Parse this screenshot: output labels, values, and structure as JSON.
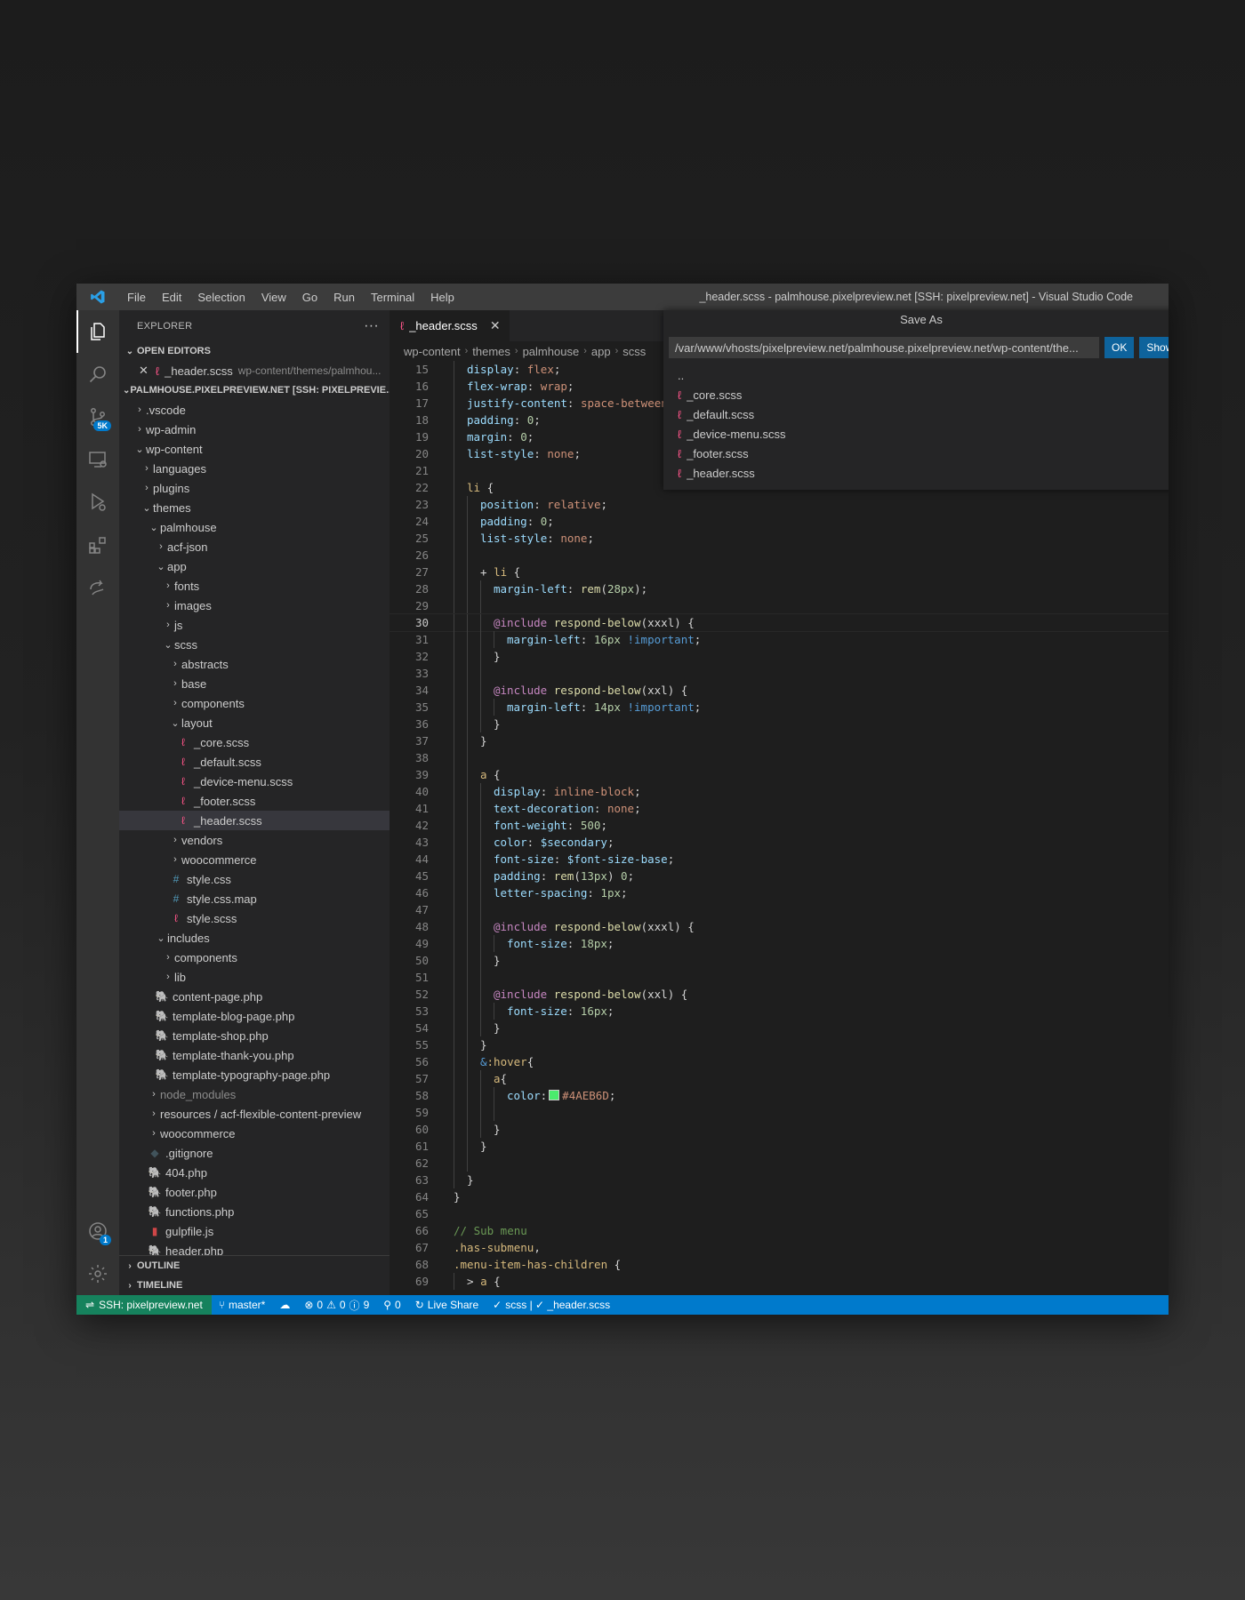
{
  "window": {
    "title": "_header.scss - palmhouse.pixelpreview.net [SSH: pixelpreview.net] - Visual Studio Code",
    "menu": [
      "File",
      "Edit",
      "Selection",
      "View",
      "Go",
      "Run",
      "Terminal",
      "Help"
    ]
  },
  "activity": {
    "source_control_badge": "5K",
    "accounts_badge": "1"
  },
  "sidebar": {
    "title": "EXPLORER",
    "more_label": "···",
    "open_editors_label": "OPEN EDITORS",
    "open_editor": {
      "name": "_header.scss",
      "path": "wp-content/themes/palmhou..."
    },
    "workspace_label": "PALMHOUSE.PIXELPREVIEW.NET [SSH: PIXELPREVIE...",
    "tree": [
      {
        "label": ".vscode",
        "depth": 0,
        "type": "folder",
        "open": false
      },
      {
        "label": "wp-admin",
        "depth": 0,
        "type": "folder",
        "open": false
      },
      {
        "label": "wp-content",
        "depth": 0,
        "type": "folder",
        "open": true
      },
      {
        "label": "languages",
        "depth": 1,
        "type": "folder",
        "open": false
      },
      {
        "label": "plugins",
        "depth": 1,
        "type": "folder",
        "open": false
      },
      {
        "label": "themes",
        "depth": 1,
        "type": "folder",
        "open": true
      },
      {
        "label": "palmhouse",
        "depth": 2,
        "type": "folder",
        "open": true
      },
      {
        "label": "acf-json",
        "depth": 3,
        "type": "folder",
        "open": false
      },
      {
        "label": "app",
        "depth": 3,
        "type": "folder",
        "open": true
      },
      {
        "label": "fonts",
        "depth": 4,
        "type": "folder",
        "open": false
      },
      {
        "label": "images",
        "depth": 4,
        "type": "folder",
        "open": false
      },
      {
        "label": "js",
        "depth": 4,
        "type": "folder",
        "open": false
      },
      {
        "label": "scss",
        "depth": 4,
        "type": "folder",
        "open": true
      },
      {
        "label": "abstracts",
        "depth": 5,
        "type": "folder",
        "open": false
      },
      {
        "label": "base",
        "depth": 5,
        "type": "folder",
        "open": false
      },
      {
        "label": "components",
        "depth": 5,
        "type": "folder",
        "open": false
      },
      {
        "label": "layout",
        "depth": 5,
        "type": "folder",
        "open": true
      },
      {
        "label": "_core.scss",
        "depth": 6,
        "type": "scss"
      },
      {
        "label": "_default.scss",
        "depth": 6,
        "type": "scss"
      },
      {
        "label": "_device-menu.scss",
        "depth": 6,
        "type": "scss"
      },
      {
        "label": "_footer.scss",
        "depth": 6,
        "type": "scss"
      },
      {
        "label": "_header.scss",
        "depth": 6,
        "type": "scss",
        "selected": true
      },
      {
        "label": "vendors",
        "depth": 5,
        "type": "folder",
        "open": false
      },
      {
        "label": "woocommerce",
        "depth": 5,
        "type": "folder",
        "open": false
      },
      {
        "label": "style.css",
        "depth": 5,
        "type": "css"
      },
      {
        "label": "style.css.map",
        "depth": 5,
        "type": "css"
      },
      {
        "label": "style.scss",
        "depth": 5,
        "type": "scss"
      },
      {
        "label": "includes",
        "depth": 3,
        "type": "folder",
        "open": true
      },
      {
        "label": "components",
        "depth": 4,
        "type": "folder",
        "open": false
      },
      {
        "label": "lib",
        "depth": 4,
        "type": "folder",
        "open": false
      },
      {
        "label": "content-page.php",
        "depth": 3,
        "type": "php"
      },
      {
        "label": "template-blog-page.php",
        "depth": 3,
        "type": "php"
      },
      {
        "label": "template-shop.php",
        "depth": 3,
        "type": "php"
      },
      {
        "label": "template-thank-you.php",
        "depth": 3,
        "type": "php"
      },
      {
        "label": "template-typography-page.php",
        "depth": 3,
        "type": "php"
      },
      {
        "label": "node_modules",
        "depth": 2,
        "type": "folder",
        "open": false,
        "dim": true
      },
      {
        "label": "resources / acf-flexible-content-preview",
        "depth": 2,
        "type": "folder",
        "open": false
      },
      {
        "label": "woocommerce",
        "depth": 2,
        "type": "folder",
        "open": false
      },
      {
        "label": ".gitignore",
        "depth": 2,
        "type": "git"
      },
      {
        "label": "404.php",
        "depth": 2,
        "type": "php"
      },
      {
        "label": "footer.php",
        "depth": 2,
        "type": "php"
      },
      {
        "label": "functions.php",
        "depth": 2,
        "type": "php"
      },
      {
        "label": "gulpfile.js",
        "depth": 2,
        "type": "gulp"
      },
      {
        "label": "header.php",
        "depth": 2,
        "type": "php"
      }
    ],
    "outline_label": "OUTLINE",
    "timeline_label": "TIMELINE"
  },
  "editor": {
    "tab_label": "_header.scss",
    "breadcrumb": [
      "wp-content",
      "themes",
      "palmhouse",
      "app",
      "scss"
    ],
    "current_line": 30,
    "lines": [
      {
        "n": 15,
        "i": 2,
        "t": [
          [
            "display",
            "k-prop"
          ],
          [
            ": ",
            "k-p"
          ],
          [
            "flex",
            "k-val"
          ],
          [
            ";",
            "k-p"
          ]
        ]
      },
      {
        "n": 16,
        "i": 2,
        "t": [
          [
            "flex-wrap",
            "k-prop"
          ],
          [
            ": ",
            "k-p"
          ],
          [
            "wrap",
            "k-val"
          ],
          [
            ";",
            "k-p"
          ]
        ]
      },
      {
        "n": 17,
        "i": 2,
        "t": [
          [
            "justify-content",
            "k-prop"
          ],
          [
            ": ",
            "k-p"
          ],
          [
            "space-between",
            "k-val"
          ],
          [
            ";",
            "k-p"
          ]
        ]
      },
      {
        "n": 18,
        "i": 2,
        "t": [
          [
            "padding",
            "k-prop"
          ],
          [
            ": ",
            "k-p"
          ],
          [
            "0",
            "k-num"
          ],
          [
            ";",
            "k-p"
          ]
        ]
      },
      {
        "n": 19,
        "i": 2,
        "t": [
          [
            "margin",
            "k-prop"
          ],
          [
            ": ",
            "k-p"
          ],
          [
            "0",
            "k-num"
          ],
          [
            ";",
            "k-p"
          ]
        ]
      },
      {
        "n": 20,
        "i": 2,
        "t": [
          [
            "list-style",
            "k-prop"
          ],
          [
            ": ",
            "k-p"
          ],
          [
            "none",
            "k-val"
          ],
          [
            ";",
            "k-p"
          ]
        ]
      },
      {
        "n": 21,
        "i": 2,
        "t": []
      },
      {
        "n": 22,
        "i": 2,
        "t": [
          [
            "li",
            "k-sel"
          ],
          [
            " {",
            "k-p"
          ]
        ]
      },
      {
        "n": 23,
        "i": 3,
        "t": [
          [
            "position",
            "k-prop"
          ],
          [
            ": ",
            "k-p"
          ],
          [
            "relative",
            "k-val"
          ],
          [
            ";",
            "k-p"
          ]
        ]
      },
      {
        "n": 24,
        "i": 3,
        "t": [
          [
            "padding",
            "k-prop"
          ],
          [
            ": ",
            "k-p"
          ],
          [
            "0",
            "k-num"
          ],
          [
            ";",
            "k-p"
          ]
        ]
      },
      {
        "n": 25,
        "i": 3,
        "t": [
          [
            "list-style",
            "k-prop"
          ],
          [
            ": ",
            "k-p"
          ],
          [
            "none",
            "k-val"
          ],
          [
            ";",
            "k-p"
          ]
        ]
      },
      {
        "n": 26,
        "i": 3,
        "t": []
      },
      {
        "n": 27,
        "i": 3,
        "t": [
          [
            "+ ",
            "k-p"
          ],
          [
            "li",
            "k-sel"
          ],
          [
            " {",
            "k-p"
          ]
        ]
      },
      {
        "n": 28,
        "i": 4,
        "t": [
          [
            "margin-left",
            "k-prop"
          ],
          [
            ": ",
            "k-p"
          ],
          [
            "rem",
            "k-fn"
          ],
          [
            "(",
            "k-p"
          ],
          [
            "28px",
            "k-num"
          ],
          [
            ");",
            "k-p"
          ]
        ]
      },
      {
        "n": 29,
        "i": 4,
        "t": []
      },
      {
        "n": 30,
        "i": 4,
        "t": [
          [
            "@include",
            "k-at"
          ],
          [
            " ",
            "k-p"
          ],
          [
            "respond-below",
            "k-fn"
          ],
          [
            "(xxxl) {",
            "k-p"
          ]
        ]
      },
      {
        "n": 31,
        "i": 5,
        "t": [
          [
            "margin-left",
            "k-prop"
          ],
          [
            ": ",
            "k-p"
          ],
          [
            "16px",
            "k-num"
          ],
          [
            " ",
            "k-p"
          ],
          [
            "!important",
            "k-imp"
          ],
          [
            ";",
            "k-p"
          ]
        ]
      },
      {
        "n": 32,
        "i": 4,
        "t": [
          [
            "}",
            "k-p"
          ]
        ]
      },
      {
        "n": 33,
        "i": 4,
        "t": []
      },
      {
        "n": 34,
        "i": 4,
        "t": [
          [
            "@include",
            "k-at"
          ],
          [
            " ",
            "k-p"
          ],
          [
            "respond-below",
            "k-fn"
          ],
          [
            "(xxl) {",
            "k-p"
          ]
        ]
      },
      {
        "n": 35,
        "i": 5,
        "t": [
          [
            "margin-left",
            "k-prop"
          ],
          [
            ": ",
            "k-p"
          ],
          [
            "14px",
            "k-num"
          ],
          [
            " ",
            "k-p"
          ],
          [
            "!important",
            "k-imp"
          ],
          [
            ";",
            "k-p"
          ]
        ]
      },
      {
        "n": 36,
        "i": 4,
        "t": [
          [
            "}",
            "k-p"
          ]
        ]
      },
      {
        "n": 37,
        "i": 3,
        "t": [
          [
            "}",
            "k-p"
          ]
        ]
      },
      {
        "n": 38,
        "i": 3,
        "t": []
      },
      {
        "n": 39,
        "i": 3,
        "t": [
          [
            "a",
            "k-sel"
          ],
          [
            " {",
            "k-p"
          ]
        ]
      },
      {
        "n": 40,
        "i": 4,
        "t": [
          [
            "display",
            "k-prop"
          ],
          [
            ": ",
            "k-p"
          ],
          [
            "inline-block",
            "k-val"
          ],
          [
            ";",
            "k-p"
          ]
        ]
      },
      {
        "n": 41,
        "i": 4,
        "t": [
          [
            "text-decoration",
            "k-prop"
          ],
          [
            ": ",
            "k-p"
          ],
          [
            "none",
            "k-val"
          ],
          [
            ";",
            "k-p"
          ]
        ]
      },
      {
        "n": 42,
        "i": 4,
        "t": [
          [
            "font-weight",
            "k-prop"
          ],
          [
            ": ",
            "k-p"
          ],
          [
            "500",
            "k-num"
          ],
          [
            ";",
            "k-p"
          ]
        ]
      },
      {
        "n": 43,
        "i": 4,
        "t": [
          [
            "color",
            "k-prop"
          ],
          [
            ": ",
            "k-p"
          ],
          [
            "$secondary",
            "k-var"
          ],
          [
            ";",
            "k-p"
          ]
        ]
      },
      {
        "n": 44,
        "i": 4,
        "t": [
          [
            "font-size",
            "k-prop"
          ],
          [
            ": ",
            "k-p"
          ],
          [
            "$font-size-base",
            "k-var"
          ],
          [
            ";",
            "k-p"
          ]
        ]
      },
      {
        "n": 45,
        "i": 4,
        "t": [
          [
            "padding",
            "k-prop"
          ],
          [
            ": ",
            "k-p"
          ],
          [
            "rem",
            "k-fn"
          ],
          [
            "(",
            "k-p"
          ],
          [
            "13px",
            "k-num"
          ],
          [
            ") ",
            "k-p"
          ],
          [
            "0",
            "k-num"
          ],
          [
            ";",
            "k-p"
          ]
        ]
      },
      {
        "n": 46,
        "i": 4,
        "t": [
          [
            "letter-spacing",
            "k-prop"
          ],
          [
            ": ",
            "k-p"
          ],
          [
            "1px",
            "k-num"
          ],
          [
            ";",
            "k-p"
          ]
        ]
      },
      {
        "n": 47,
        "i": 4,
        "t": []
      },
      {
        "n": 48,
        "i": 4,
        "t": [
          [
            "@include",
            "k-at"
          ],
          [
            " ",
            "k-p"
          ],
          [
            "respond-below",
            "k-fn"
          ],
          [
            "(xxxl) {",
            "k-p"
          ]
        ]
      },
      {
        "n": 49,
        "i": 5,
        "t": [
          [
            "font-size",
            "k-prop"
          ],
          [
            ": ",
            "k-p"
          ],
          [
            "18px",
            "k-num"
          ],
          [
            ";",
            "k-p"
          ]
        ]
      },
      {
        "n": 50,
        "i": 4,
        "t": [
          [
            "}",
            "k-p"
          ]
        ]
      },
      {
        "n": 51,
        "i": 4,
        "t": []
      },
      {
        "n": 52,
        "i": 4,
        "t": [
          [
            "@include",
            "k-at"
          ],
          [
            " ",
            "k-p"
          ],
          [
            "respond-below",
            "k-fn"
          ],
          [
            "(xxl) {",
            "k-p"
          ]
        ]
      },
      {
        "n": 53,
        "i": 5,
        "t": [
          [
            "font-size",
            "k-prop"
          ],
          [
            ": ",
            "k-p"
          ],
          [
            "16px",
            "k-num"
          ],
          [
            ";",
            "k-p"
          ]
        ]
      },
      {
        "n": 54,
        "i": 4,
        "t": [
          [
            "}",
            "k-p"
          ]
        ]
      },
      {
        "n": 55,
        "i": 3,
        "t": [
          [
            "}",
            "k-p"
          ]
        ]
      },
      {
        "n": 56,
        "i": 3,
        "t": [
          [
            "&",
            "k-imp"
          ],
          [
            ":hover",
            "k-sel"
          ],
          [
            "{",
            "k-p"
          ]
        ]
      },
      {
        "n": 57,
        "i": 4,
        "t": [
          [
            "a",
            "k-sel"
          ],
          [
            "{",
            "k-p"
          ]
        ]
      },
      {
        "n": 58,
        "i": 5,
        "t": [
          [
            "color",
            "k-prop"
          ],
          [
            ":",
            "k-p"
          ],
          [
            "#SWATCH#",
            "k-p"
          ],
          [
            "#4AEB6D",
            "k-val"
          ],
          [
            ";",
            "k-p"
          ]
        ]
      },
      {
        "n": 59,
        "i": 5,
        "t": []
      },
      {
        "n": 60,
        "i": 4,
        "t": [
          [
            "}",
            "k-p"
          ]
        ]
      },
      {
        "n": 61,
        "i": 3,
        "t": [
          [
            "}",
            "k-p"
          ]
        ]
      },
      {
        "n": 62,
        "i": 3,
        "t": []
      },
      {
        "n": 63,
        "i": 2,
        "t": [
          [
            "}",
            "k-p"
          ]
        ]
      },
      {
        "n": 64,
        "i": 1,
        "t": [
          [
            "}",
            "k-p"
          ]
        ]
      },
      {
        "n": 65,
        "i": 1,
        "t": []
      },
      {
        "n": 66,
        "i": 1,
        "t": [
          [
            "// Sub menu",
            "k-com"
          ]
        ]
      },
      {
        "n": 67,
        "i": 1,
        "t": [
          [
            ".has-submenu",
            "k-sel"
          ],
          [
            ",",
            "k-p"
          ]
        ]
      },
      {
        "n": 68,
        "i": 1,
        "t": [
          [
            ".menu-item-has-children",
            "k-sel"
          ],
          [
            " {",
            "k-p"
          ]
        ]
      },
      {
        "n": 69,
        "i": 2,
        "t": [
          [
            "> ",
            "k-p"
          ],
          [
            "a",
            "k-sel"
          ],
          [
            " {",
            "k-p"
          ]
        ]
      }
    ]
  },
  "save_as": {
    "title": "Save As",
    "path_value": "/var/www/vhosts/pixelpreview.net/palmhouse.pixelpreview.net/wp-content/the...",
    "ok_label": "OK",
    "show_local_label": "Show Local",
    "parent_label": "..",
    "files": [
      "_core.scss",
      "_default.scss",
      "_device-menu.scss",
      "_footer.scss",
      "_header.scss"
    ]
  },
  "statusbar": {
    "remote": "SSH: pixelpreview.net",
    "branch": "master*",
    "errors": "0",
    "warnings": "0",
    "infos": "9",
    "ports": "0",
    "live_share": "Live Share",
    "linter": "scss | ✓ _header.scss"
  },
  "colors": {
    "accent": "#007acc",
    "remote": "#16825d",
    "scss_icon": "#f55385",
    "css_icon": "#519aba",
    "php_icon": "#a074c4"
  }
}
